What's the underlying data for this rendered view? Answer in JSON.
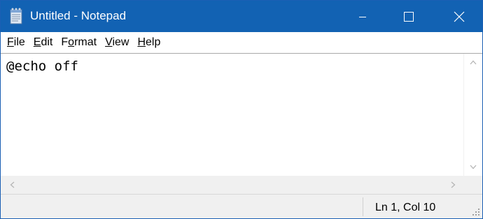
{
  "window": {
    "title": "Untitled - Notepad",
    "app_icon": "notepad-icon",
    "controls": [
      "minimize-icon",
      "maximize-icon",
      "close-icon"
    ],
    "accent_color": "#1262b3"
  },
  "menu": {
    "items": [
      {
        "mnemonic": "F",
        "rest": "ile"
      },
      {
        "mnemonic": "E",
        "rest": "dit"
      },
      {
        "pre": "F",
        "mnemonic": "o",
        "rest": "rmat"
      },
      {
        "mnemonic": "V",
        "rest": "iew"
      },
      {
        "mnemonic": "H",
        "rest": "elp"
      }
    ]
  },
  "editor": {
    "content": "@echo off"
  },
  "status": {
    "position": "Ln 1, Col 10"
  }
}
